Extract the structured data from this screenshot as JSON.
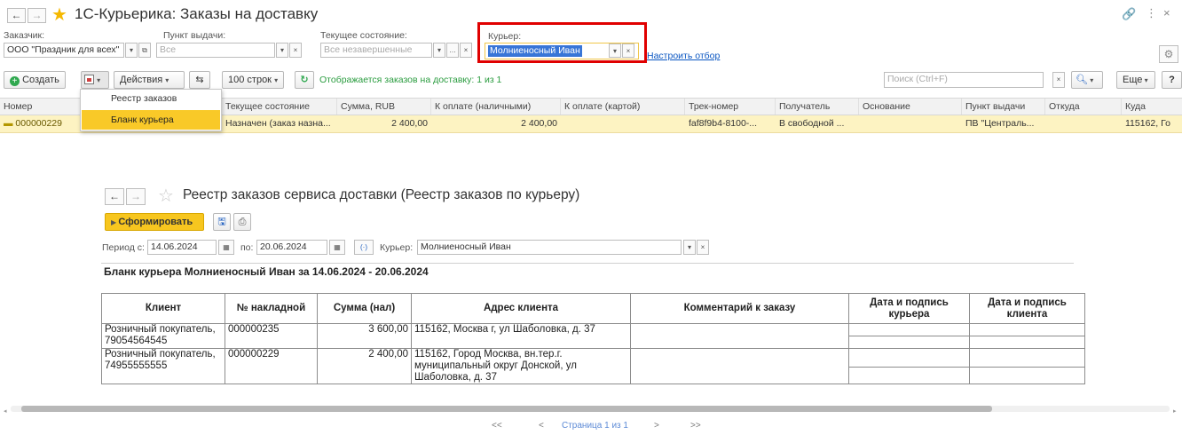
{
  "window": {
    "title": "1С-Курьерика: Заказы на доставку",
    "back": "←",
    "forward": "→",
    "star": "★"
  },
  "filters": {
    "customer_label": "Заказчик:",
    "customer_value": "ООО \"Праздник для всех\"",
    "point_label": "Пункт выдачи:",
    "point_placeholder": "Все",
    "state_label": "Текущее состояние:",
    "state_placeholder": "Все незавершенные",
    "courier_label": "Курьер:",
    "courier_value": "Молниеносный Иван",
    "setup_link": "Настроить отбор"
  },
  "toolbar": {
    "create": "Создать",
    "actions": "Действия",
    "rows": "100 строк",
    "info": "Отображается заказов на доставку: 1 из 1",
    "search_placeholder": "Поиск (Ctrl+F)",
    "more": "Еще",
    "help": "?"
  },
  "print_menu": [
    "Реестр заказов",
    "Бланк курьера"
  ],
  "table": {
    "headers": [
      "Номер",
      "Текущее состояние",
      "Сумма, RUB",
      "К оплате (наличными)",
      "К оплате (картой)",
      "Трек-номер",
      "Получатель",
      "Основание",
      "Пункт выдачи",
      "Откуда",
      "Куда"
    ],
    "row": {
      "number": "000000229",
      "state": "Назначен (заказ назна...",
      "sum": "2 400,00",
      "cash": "2 400,00",
      "card": "",
      "track": "faf8f9b4-8100-...",
      "recipient": "В свободной ...",
      "basis": "",
      "point": "ПВ \"Централь...",
      "from": "",
      "to": "115162, Го"
    }
  },
  "report": {
    "title": "Реестр заказов сервиса доставки (Реестр заказов по курьеру)",
    "generate": "Сформировать",
    "period_from_label": "Период с:",
    "date_from": "14.06.2024",
    "period_to_label": "по:",
    "date_to": "20.06.2024",
    "courier_label": "Курьер:",
    "courier_value": "Молниеносный Иван",
    "heading": "Бланк курьера Молниеносный Иван за 14.06.2024 - 20.06.2024",
    "columns": [
      "Клиент",
      "№ накладной",
      "Сумма (нал)",
      "Адрес клиента",
      "Комментарий к заказу",
      "Дата и подпись курьера",
      "Дата и подпись клиента"
    ],
    "rows": [
      {
        "client": "Розничный покупатель, 79054564545",
        "invoice": "000000235",
        "sum": "3 600,00",
        "address": "115162, Москва г, ул Шаболовка, д. 37",
        "comment": ""
      },
      {
        "client": "Розничный покупатель, 74955555555",
        "invoice": "000000229",
        "sum": "2 400,00",
        "address": "115162, Город Москва, вн.тер.г. муниципальный округ Донской, ул Шаболовка, д. 37",
        "comment": ""
      }
    ]
  },
  "pager": {
    "first": "<<",
    "prev": "<",
    "text": "Страница 1 из 1",
    "next": ">",
    "last": ">>"
  },
  "colors": {
    "highlight_box": "#e00000",
    "selected_row": "#fdf3c2",
    "menu_selected": "#f9c928",
    "generate_btn": "#f7c61f",
    "link": "#0a56c2",
    "create_icon": "#2fa84f"
  }
}
